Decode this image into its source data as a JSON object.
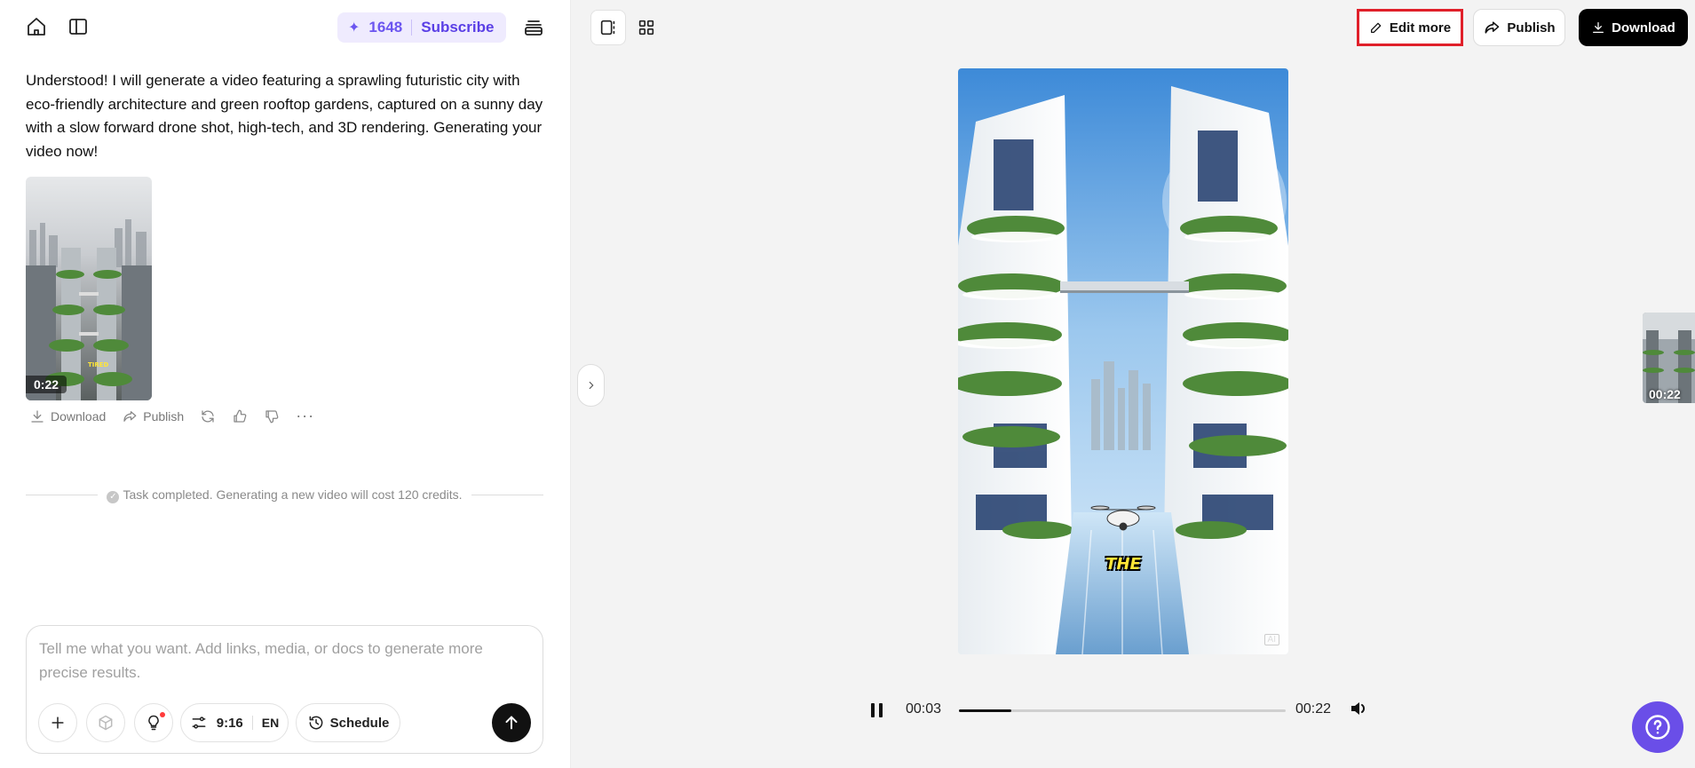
{
  "sidebar": {
    "credits": "1648",
    "subscribe_label": "Subscribe",
    "message": "Understood! I will generate a video featuring a sprawling futuristic city with eco-friendly architecture and green rooftop gardens, captured on a sunny day with a slow forward drone shot, high-tech, and 3D rendering. Generating your video now!",
    "thumbnail_duration": "0:22",
    "actions": {
      "download": "Download",
      "publish": "Publish"
    },
    "task_status": "Task completed. Generating a new video will cost 120 credits."
  },
  "composer": {
    "placeholder": "Tell me what you want. Add links, media, or docs to generate more precise results.",
    "value": "",
    "aspect_ratio": "9:16",
    "language": "EN",
    "schedule_label": "Schedule"
  },
  "header": {
    "edit_more": "Edit more",
    "publish": "Publish",
    "download": "Download"
  },
  "video": {
    "caption": "THE",
    "ai_badge": "AI",
    "current_time": "00:03",
    "total_time": "00:22",
    "progress": 0.16
  },
  "side_thumbnail": {
    "duration": "00:22"
  },
  "colors": {
    "accent": "#6a4ee8",
    "highlight": "#e0202a",
    "credits_bg": "#efebfe"
  }
}
